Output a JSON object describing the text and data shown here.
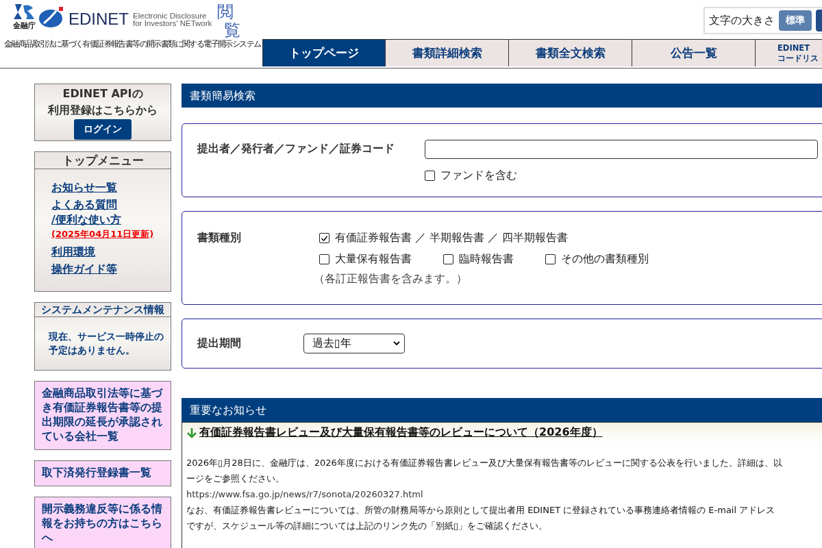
{
  "header": {
    "agency": "金融庁",
    "logo_text": "EDINET",
    "tagline_lines": [
      "Electronic Disclosure",
      "for Investors' NETwork"
    ],
    "mode_chars": [
      "閲",
      "覧"
    ],
    "subtitle": "金融商品取引法に基づく有価証券報告書等の開示書類に関する電子開示システム",
    "font_size": {
      "label": "文字の大きさ",
      "options": [
        {
          "label": "標準",
          "selected": true
        }
      ]
    }
  },
  "nav_tabs": [
    {
      "lines": [
        "トップページ"
      ],
      "selected": true
    },
    {
      "lines": [
        "書類詳細検索"
      ],
      "selected": false
    },
    {
      "lines": [
        "書類全文検索"
      ],
      "selected": false
    },
    {
      "lines": [
        "公告一覧"
      ],
      "selected": false
    },
    {
      "lines": [
        "EDINET",
        "コードリス"
      ],
      "selected": false
    }
  ],
  "sidebar": {
    "api_box": {
      "lines": [
        "EDINET APIの",
        "利用登録はこちらから"
      ],
      "button": "ログイン"
    },
    "top_menu": {
      "title": "トップメニュー",
      "items": [
        {
          "kind": "link",
          "lines": [
            "お知らせ一覧"
          ]
        },
        {
          "kind": "link",
          "lines": [
            "よくある質問",
            "/便利な使い方"
          ]
        },
        {
          "kind": "update",
          "lines": [
            "(2025年04月11日更新)"
          ]
        },
        {
          "kind": "link",
          "lines": [
            "利用環境"
          ]
        },
        {
          "kind": "link",
          "lines": [
            "操作ガイド等"
          ]
        }
      ]
    },
    "maintenance": {
      "title": "システムメンテナンス情報",
      "lines": [
        "現在、サービス一時停止の",
        "予定はありません。"
      ]
    },
    "links": [
      {
        "lines": [
          "金融商品取引法等に基づ",
          "き有価証券報告書等の提",
          "出期限の延長が承認され",
          "ている会社一覧"
        ]
      },
      {
        "lines": [
          "取下済発行登録書一覧"
        ]
      },
      {
        "lines": [
          "開示義務違反等に係る情",
          "報をお持ちの方はこちら",
          "へ"
        ]
      }
    ]
  },
  "search": {
    "title": "書類簡易検索",
    "filer": {
      "label": "提出者／発行者／ファンド／証券コード",
      "fund_checkbox": {
        "label": "ファンドを含む",
        "checked": false
      }
    },
    "doc_type": {
      "label": "書類種別",
      "options": [
        {
          "label": "有価証券報告書 ／ 半期報告書 ／ 四半期報告書",
          "checked": true
        },
        {
          "label": "大量保有報告書",
          "checked": false
        },
        {
          "label": "臨時報告書",
          "checked": false
        },
        {
          "label": "その他の書類種別",
          "checked": false
        }
      ],
      "note": "（各訂正報告書を含みます。）"
    },
    "period": {
      "label": "提出期間",
      "value": "過去▯年"
    }
  },
  "notices": {
    "title": "重要なお知らせ",
    "items": [
      {
        "title": "有価証券報告書レビュー及び大量保有報告書等のレビューについて（2026年度）",
        "lines": [
          "2026年▯月28日に、金融庁は、2026年度における有価証券報告書レビュー及び大量保有報告書等のレビューに関する公表を行いました。詳細は、以",
          "ージをご参照ください。",
          "https://www.fsa.go.jp/news/r7/sonota/20260327.html",
          "なお、有価証券報告書レビューについては、所管の財務局等から原則として提出者用 EDINET に登録されている事務連絡者情報の E-mail アドレス",
          "ですが、スケジュール等の詳細については上記のリンク先の「別紙▯」をご確認ください。"
        ]
      }
    ]
  }
}
